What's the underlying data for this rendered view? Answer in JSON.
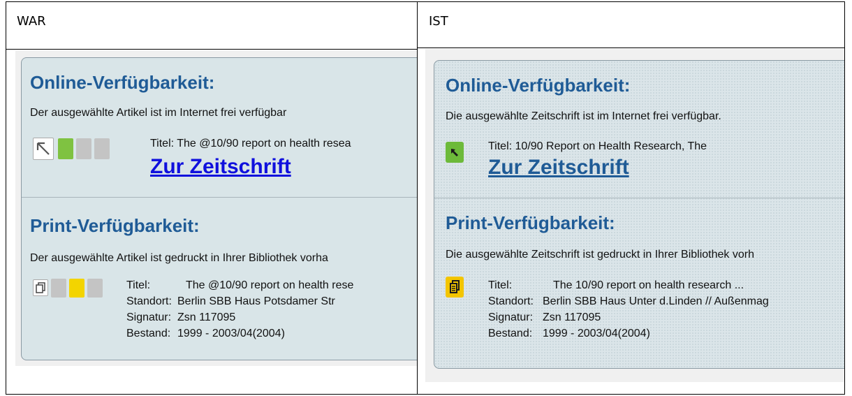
{
  "columns": {
    "left_header": "WAR",
    "right_header": "IST"
  },
  "war": {
    "online": {
      "heading": "Online-Verfügbarkeit:",
      "description": "Der ausgewählte Artikel ist im Internet frei verfügbar",
      "title_line": "Titel: The @10/90 report on health resea",
      "link": "Zur Zeitschrift"
    },
    "print": {
      "heading": "Print-Verfügbarkeit:",
      "description": "Der ausgewählte Artikel ist gedruckt in Ihrer Bibliothek vorha",
      "labels": [
        "Titel:",
        "Standort:",
        "Signatur:",
        "Bestand:"
      ],
      "values": [
        "The @10/90 report on health rese",
        "Berlin SBB Haus Potsdamer Str",
        "Zsn 117095",
        "1999 - 2003/04(2004)"
      ]
    },
    "traffic_colors": {
      "green": "#7fc241",
      "yellow": "#f3d400",
      "grey": "#c4c4c4"
    }
  },
  "ist": {
    "online": {
      "heading": "Online-Verfügbarkeit:",
      "description": "Die ausgewählte Zeitschrift ist im Internet frei verfügbar.",
      "title_line": "Titel: 10/90 Report on Health Research, The",
      "link": "Zur Zeitschrift"
    },
    "print": {
      "heading": "Print-Verfügbarkeit:",
      "description": "Die ausgewählte Zeitschrift ist gedruckt in Ihrer Bibliothek vorh",
      "labels": [
        "Titel:",
        "Standort:",
        "Signatur:",
        "Bestand:"
      ],
      "values": [
        "The 10/90 report on health research ...",
        "Berlin SBB Haus Unter d.Linden // Außenmag",
        "Zsn 117095",
        "1999 - 2003/04(2004)"
      ]
    },
    "icon_colors": {
      "online": "#6dba3a",
      "print": "#f3c500"
    }
  }
}
